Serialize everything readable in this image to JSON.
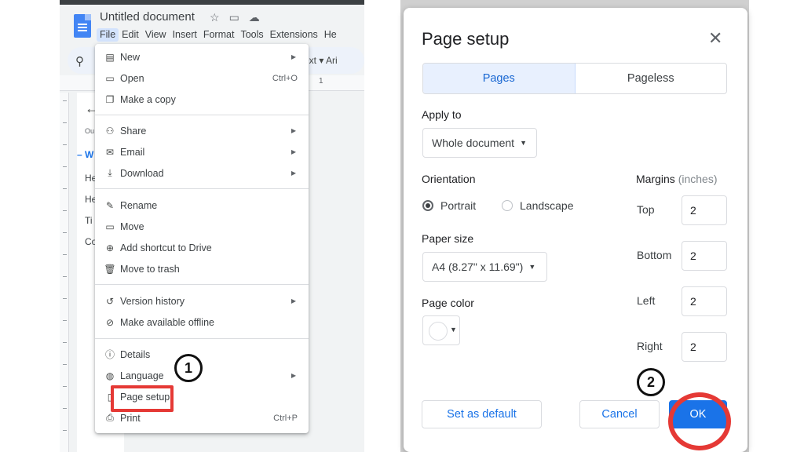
{
  "docs": {
    "title": "Untitled document",
    "title_icons": [
      "star-icon",
      "folder-move-icon",
      "cloud-icon"
    ],
    "menubar": [
      "File",
      "Edit",
      "View",
      "Insert",
      "Format",
      "Tools",
      "Extensions",
      "He"
    ],
    "toolbar_text": "ext ▾  Ari",
    "ruler_number": "1",
    "outline": {
      "small": "Ou",
      "line": "– W",
      "items": [
        "He",
        "He",
        "Ti",
        "Co"
      ]
    },
    "file_menu": {
      "groups": [
        [
          {
            "icon": "new-doc-icon",
            "label": "New",
            "submenu": true
          },
          {
            "icon": "folder-open-icon",
            "label": "Open",
            "shortcut": "Ctrl+O"
          },
          {
            "icon": "copy-icon",
            "label": "Make a copy"
          }
        ],
        [
          {
            "icon": "share-icon",
            "label": "Share",
            "submenu": true
          },
          {
            "icon": "email-icon",
            "label": "Email",
            "submenu": true
          },
          {
            "icon": "download-icon",
            "label": "Download",
            "submenu": true
          }
        ],
        [
          {
            "icon": "rename-icon",
            "label": "Rename"
          },
          {
            "icon": "move-icon",
            "label": "Move"
          },
          {
            "icon": "drive-shortcut-icon",
            "label": "Add shortcut to Drive"
          },
          {
            "icon": "trash-icon",
            "label": "Move to trash"
          }
        ],
        [
          {
            "icon": "history-icon",
            "label": "Version history",
            "submenu": true
          },
          {
            "icon": "offline-icon",
            "label": "Make available offline"
          }
        ],
        [
          {
            "icon": "info-icon",
            "label": "Details"
          },
          {
            "icon": "globe-icon",
            "label": "Language",
            "submenu": true
          },
          {
            "icon": "page-setup-icon",
            "label": "Page setup"
          },
          {
            "icon": "print-icon",
            "label": "Print",
            "shortcut": "Ctrl+P"
          }
        ]
      ]
    },
    "step1": "1"
  },
  "dialog": {
    "title": "Page setup",
    "tabs": {
      "pages": "Pages",
      "pageless": "Pageless"
    },
    "apply_to_label": "Apply to",
    "apply_to_value": "Whole document",
    "orientation_label": "Orientation",
    "portrait": "Portrait",
    "landscape": "Landscape",
    "paper_size_label": "Paper size",
    "paper_size_value": "A4 (8.27\" x 11.69\")",
    "page_color_label": "Page color",
    "margins_label": "Margins",
    "margins_unit": "(inches)",
    "margins": {
      "top_label": "Top",
      "top": "2",
      "bottom_label": "Bottom",
      "bottom": "2",
      "left_label": "Left",
      "left": "2",
      "right_label": "Right",
      "right": "2"
    },
    "buttons": {
      "set_default": "Set as default",
      "cancel": "Cancel",
      "ok": "OK"
    },
    "step2": "2"
  },
  "colors": {
    "accent": "#1a73e8",
    "highlight": "#e53935"
  }
}
